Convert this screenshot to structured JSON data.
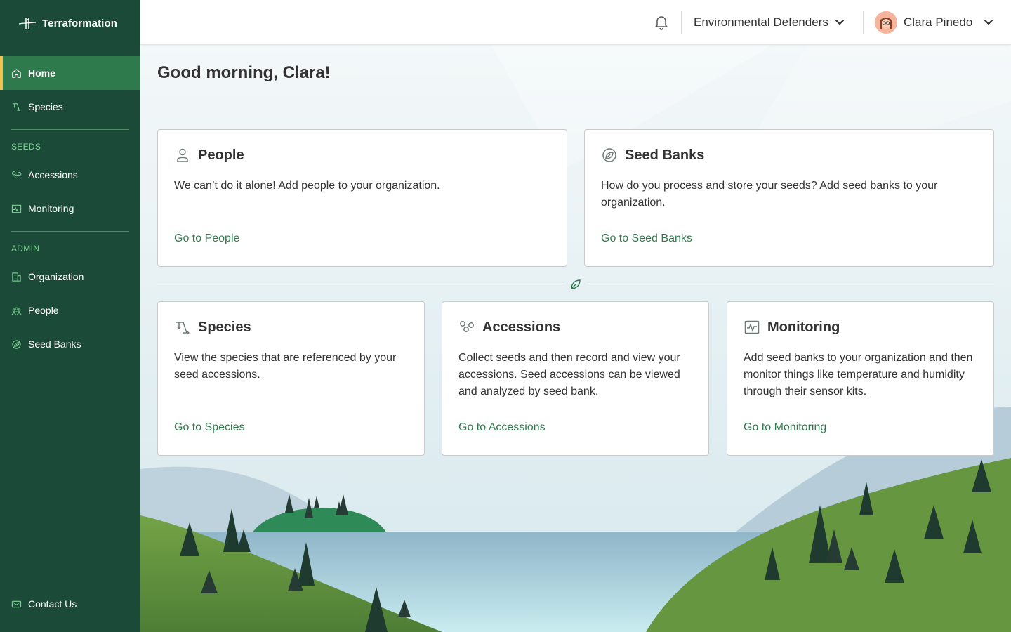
{
  "app": {
    "brand": "Terraformation"
  },
  "sidebar": {
    "items": [
      {
        "label": "Home",
        "icon": "home-icon",
        "active": true
      },
      {
        "label": "Species",
        "icon": "species-icon"
      }
    ],
    "seeds_section": "SEEDS",
    "seeds_items": [
      {
        "label": "Accessions",
        "icon": "accessions-icon"
      },
      {
        "label": "Monitoring",
        "icon": "monitoring-icon"
      }
    ],
    "admin_section": "ADMIN",
    "admin_items": [
      {
        "label": "Organization",
        "icon": "organization-icon"
      },
      {
        "label": "People",
        "icon": "people-icon"
      },
      {
        "label": "Seed Banks",
        "icon": "seed-banks-icon"
      }
    ],
    "footer": {
      "label": "Contact Us",
      "icon": "mail-icon"
    }
  },
  "header": {
    "organization": "Environmental Defenders",
    "user_name": "Clara Pinedo"
  },
  "main": {
    "greeting": "Good morning, Clara!",
    "cards": [
      {
        "title": "People",
        "icon": "person-icon",
        "description": "We can’t do it alone! Add people to your organization.",
        "link": "Go to People"
      },
      {
        "title": "Seed Banks",
        "icon": "seed-bank-icon",
        "description": "How do you process and store your seeds? Add seed banks to your organization.",
        "link": "Go to Seed Banks"
      },
      {
        "title": "Species",
        "icon": "species-icon",
        "description": "View the species that are referenced by your seed accessions.",
        "link": "Go to Species"
      },
      {
        "title": "Accessions",
        "icon": "accessions-icon",
        "description": "Collect seeds and then record and view your accessions. Seed accessions can be viewed and analyzed by seed bank.",
        "link": "Go to Accessions"
      },
      {
        "title": "Monitoring",
        "icon": "monitoring-icon",
        "description": "Add seed banks to your organization and then monitor things like temperature and humidity through their sensor kits.",
        "link": "Go to Monitoring"
      }
    ]
  },
  "colors": {
    "sidebar_bg": "#1b4a38",
    "active_item": "#2f7a4d",
    "active_accent": "#f2c14b",
    "link": "#2f7a4d"
  }
}
